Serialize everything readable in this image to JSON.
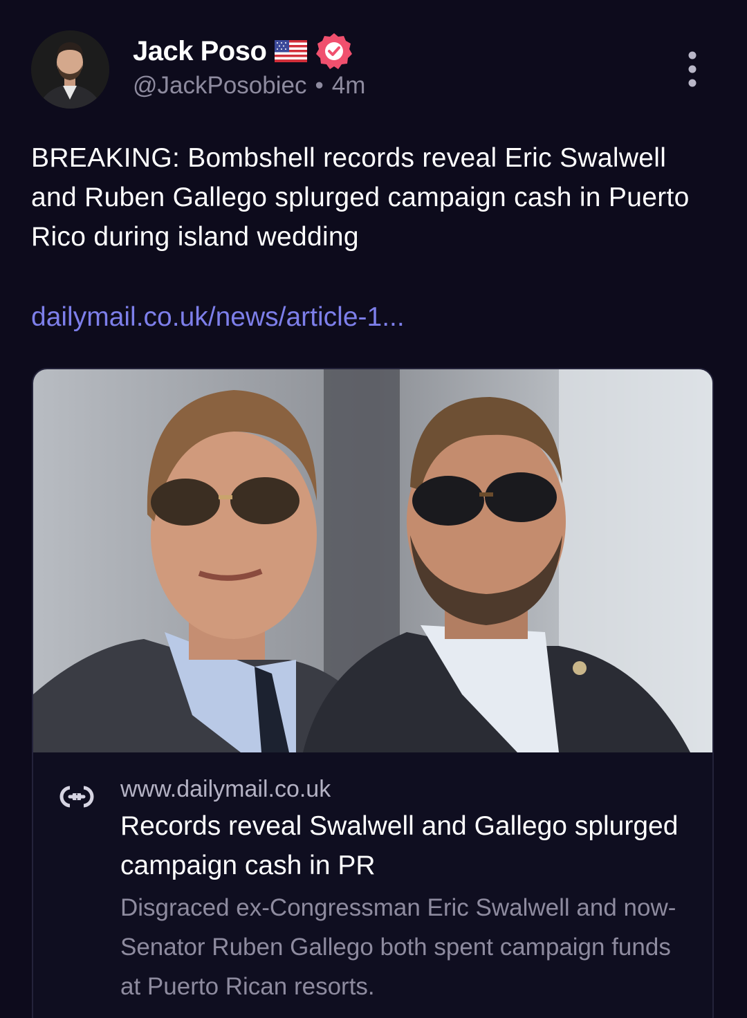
{
  "post": {
    "author": {
      "display_name": "Jack Poso",
      "flag_icon": "us-flag-icon",
      "verified_icon": "verified-badge-icon",
      "verified_color": "#f0506e",
      "handle": "@JackPosobiec",
      "separator": "•",
      "time_ago": "4m"
    },
    "more_icon": "more-vertical-icon",
    "text": "BREAKING: Bombshell records reveal Eric Swalwell and Ruben Gallego splurged campaign cash in Puerto Rico during island wedding",
    "link_text": "dailymail.co.uk/news/article-1...",
    "link_color": "#7d7fea"
  },
  "link_card": {
    "link_icon": "link-icon",
    "domain": "www.dailymail.co.uk",
    "title": "Records reveal Swalwell and Gallego splurged campaign cash in PR",
    "description": "Disgraced ex-Congressman Eric Swalwell and now-Senator Ruben Gallego both spent campaign funds at Puerto Rican resorts."
  },
  "colors": {
    "background": "#0d0b1c",
    "text_primary": "#ffffff",
    "text_secondary": "#8e8b9f"
  }
}
